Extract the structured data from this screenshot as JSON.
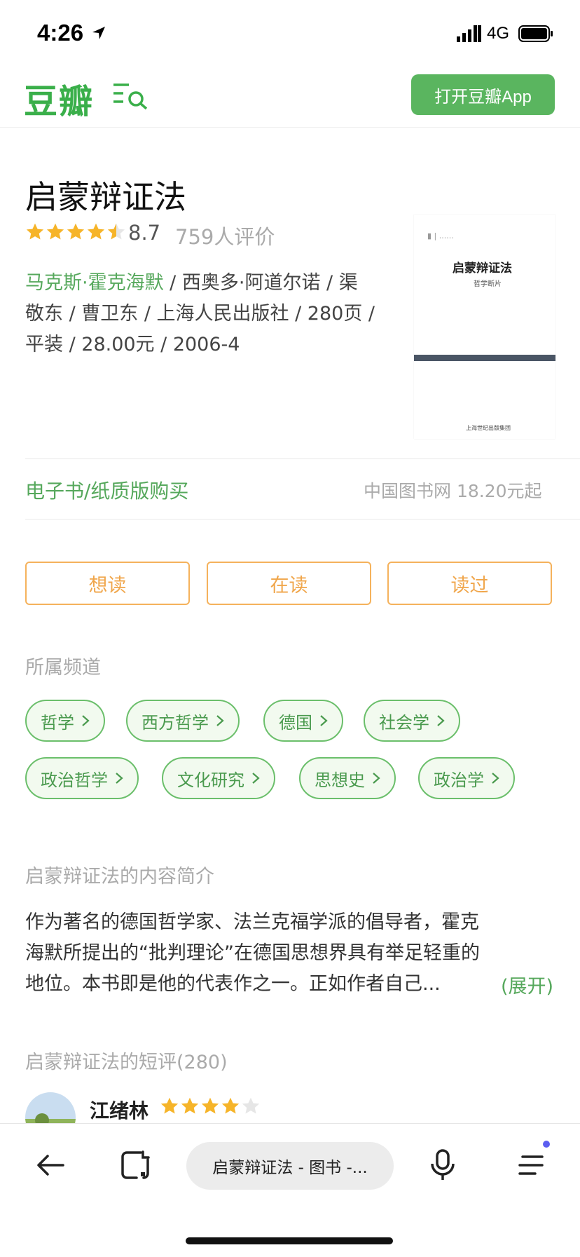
{
  "status_bar": {
    "time": "4:26",
    "network": "4G"
  },
  "header": {
    "logo": "豆瓣",
    "open_app_label": "打开豆瓣App",
    "brand_color": "#3aaf4a"
  },
  "book": {
    "title": "启蒙辩证法",
    "rating": "8.7",
    "rating_stars": 4.5,
    "rating_count": "759人评价",
    "author_link": "马克斯·霍克海默",
    "meta_rest_line1": " / 西奥多·阿道尔诺 / 渠",
    "meta_line2": "敬东 / 曹卫东 / 上海人民出版社 / 280页 /",
    "meta_line3": "平装 / 28.00元 / 2006-4",
    "cover": {
      "title": "启蒙辩证法",
      "subtitle": "哲学断片",
      "publisher": "上海世纪出版集团"
    }
  },
  "purchase": {
    "label": "电子书/纸质版购买",
    "price": "中国图书网 18.20元起"
  },
  "actions": {
    "want": "想读",
    "reading": "在读",
    "read": "读过"
  },
  "channels": {
    "label": "所属频道",
    "tags": [
      "哲学",
      "西方哲学",
      "德国",
      "社会学",
      "政治哲学",
      "文化研究",
      "思想史",
      "政治学"
    ]
  },
  "intro": {
    "label": "启蒙辩证法的内容简介",
    "text": "作为著名的德国哲学家、法兰克福学派的倡导者，霍克海默所提出的“批判理论”在德国思想界具有举足轻重的地位。本书即是他的代表作之一。正如作者自己...",
    "expand": "(展开)"
  },
  "reviews": {
    "label": "启蒙辩证法的短评(280)",
    "first_user": "江绪林",
    "first_user_stars": 4
  },
  "bottom_bar": {
    "url_label": "启蒙辩证法 - 图书 -..."
  },
  "colors": {
    "star": "#f6b429",
    "action": "#f0a64b",
    "tag_border": "#6bbf6b"
  }
}
